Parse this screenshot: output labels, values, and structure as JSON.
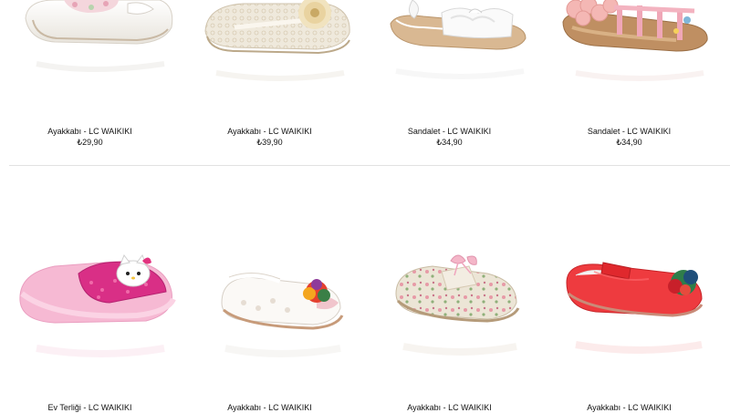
{
  "products_row1": [
    {
      "title": "Ayakkabı - LC WAIKIKI",
      "price": "₺29,90",
      "image": "white-ballet-flat-floral-lining-image",
      "color": "#f1ede6"
    },
    {
      "title": "Ayakkabı - LC WAIKIKI",
      "price": "₺39,90",
      "image": "cream-lace-flat-flower-image",
      "color": "#ede7d9"
    },
    {
      "title": "Sandalet - LC WAIKIKI",
      "price": "₺34,90",
      "image": "white-scalloped-sandal-image",
      "color": "#f5f5f5"
    },
    {
      "title": "Sandalet - LC WAIKIKI",
      "price": "₺34,90",
      "image": "pink-flower-sandal-image",
      "color": "#f4b8b8"
    }
  ],
  "products_row2": [
    {
      "title": "Ev Terliği - LC WAIKIKI",
      "image": "pink-fluffy-kitty-slipper-image",
      "color": "#f2a7c9"
    },
    {
      "title": "Ayakkabı - LC WAIKIKI",
      "image": "white-peep-toe-flower-flat-image",
      "color": "#f7f3f0"
    },
    {
      "title": "Ayakkabı - LC WAIKIKI",
      "image": "floral-print-lace-up-shoe-image",
      "color": "#e9e2d4"
    },
    {
      "title": "Ayakkabı - LC WAIKIKI",
      "image": "red-mary-jane-flower-image",
      "color": "#e8383d"
    }
  ]
}
